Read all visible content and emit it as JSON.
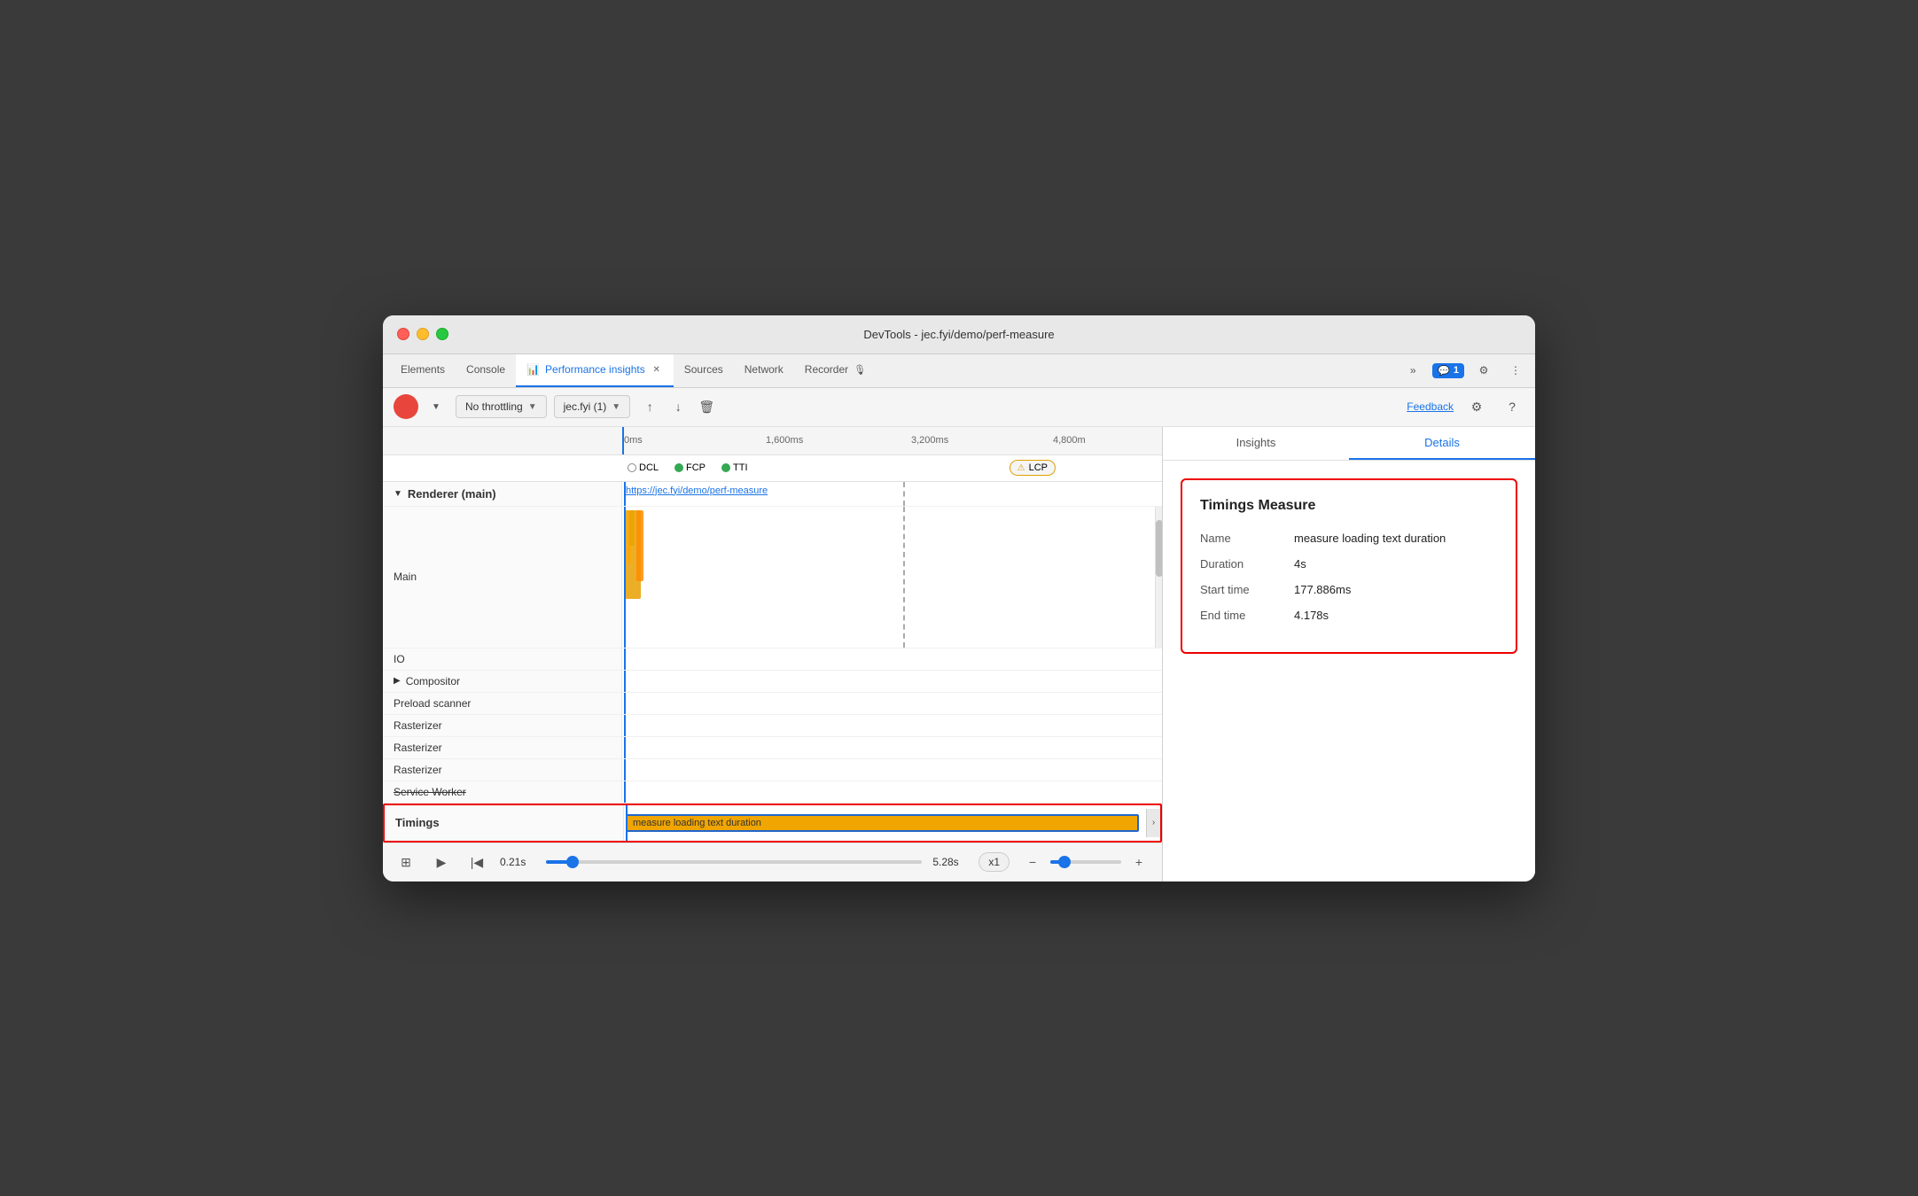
{
  "window": {
    "title": "DevTools - jec.fyi/demo/perf-measure"
  },
  "traffic_lights": {
    "red": "close",
    "yellow": "minimize",
    "green": "maximize"
  },
  "tabs": [
    {
      "id": "elements",
      "label": "Elements",
      "active": false,
      "closeable": false
    },
    {
      "id": "console",
      "label": "Console",
      "active": false,
      "closeable": false
    },
    {
      "id": "performance-insights",
      "label": "Performance insights",
      "active": true,
      "closeable": true,
      "has_icon": true
    },
    {
      "id": "sources",
      "label": "Sources",
      "active": false,
      "closeable": false
    },
    {
      "id": "network",
      "label": "Network",
      "active": false,
      "closeable": false
    },
    {
      "id": "recorder",
      "label": "Recorder",
      "active": false,
      "closeable": false,
      "has_icon": true
    }
  ],
  "tabbar_right": {
    "more_label": "»",
    "chat_badge": "1",
    "settings_icon": "⚙",
    "more_icon": "⋮"
  },
  "toolbar": {
    "record_label": "Record",
    "throttling_label": "No throttling",
    "url_selector_label": "jec.fyi (1)",
    "upload_icon": "↑",
    "download_icon": "↓",
    "delete_icon": "🗑",
    "feedback_label": "Feedback",
    "settings_icon": "⚙",
    "help_icon": "?"
  },
  "timeline": {
    "time_markers": [
      "0ms",
      "1,600ms",
      "3,200ms",
      "4,800m"
    ],
    "time_marker_positions": [
      "0%",
      "27%",
      "54%",
      "81%"
    ],
    "nav_markers": [
      {
        "id": "dcl",
        "label": "DCL",
        "type": "circle"
      },
      {
        "id": "fcp",
        "label": "FCP",
        "color": "#34a853"
      },
      {
        "id": "tti",
        "label": "TTI",
        "color": "#34a853"
      }
    ],
    "lcp_marker": "LCP",
    "tracks": [
      {
        "id": "renderer",
        "label": "Renderer (main)",
        "type": "section-header",
        "expandable": true
      },
      {
        "id": "main",
        "label": "Main",
        "type": "main"
      },
      {
        "id": "io",
        "label": "IO",
        "type": "simple"
      },
      {
        "id": "compositor",
        "label": "Compositor",
        "type": "simple",
        "expandable": true
      },
      {
        "id": "preload-scanner",
        "label": "Preload scanner",
        "type": "simple"
      },
      {
        "id": "rasterizer1",
        "label": "Rasterizer",
        "type": "simple"
      },
      {
        "id": "rasterizer2",
        "label": "Rasterizer",
        "type": "simple"
      },
      {
        "id": "rasterizer3",
        "label": "Rasterizer",
        "type": "simple"
      },
      {
        "id": "service-worker",
        "label": "Service Worker",
        "type": "strikethrough"
      }
    ],
    "timings_row": {
      "label": "Timings",
      "bar_label": "measure loading text duration",
      "bar_color": "#f0a500"
    },
    "url": "https://jec.fyi/demo/perf-measure"
  },
  "bottom_controls": {
    "thumbnail_icon": "⊞",
    "play_icon": "▶",
    "skip_icon": "|◀",
    "time_start": "0.21s",
    "time_end": "5.28s",
    "speed_label": "x1",
    "zoom_minus": "−",
    "zoom_plus": "+"
  },
  "details_panel": {
    "tabs": [
      {
        "id": "insights",
        "label": "Insights",
        "active": false
      },
      {
        "id": "details",
        "label": "Details",
        "active": true
      }
    ],
    "timings_measure": {
      "title": "Timings Measure",
      "fields": [
        {
          "label": "Name",
          "value": "measure loading text duration"
        },
        {
          "label": "Duration",
          "value": "4s"
        },
        {
          "label": "Start time",
          "value": "177.886ms"
        },
        {
          "label": "End time",
          "value": "4.178s"
        }
      ]
    }
  }
}
